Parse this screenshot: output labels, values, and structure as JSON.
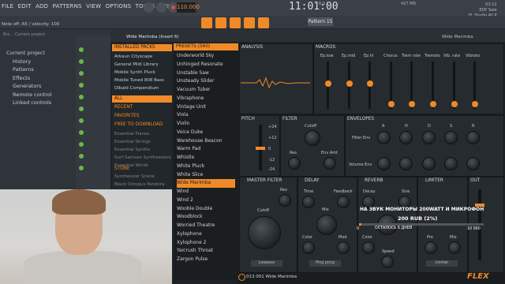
{
  "menu": [
    "FILE",
    "EDIT",
    "ADD",
    "PATTERNS",
    "VIEW",
    "OPTIONS",
    "TOOLS",
    "HELP"
  ],
  "transport": {
    "tempo": "110.000",
    "time": "11:01:00",
    "bst": "B:S:T",
    "pattern": "Pattern 15"
  },
  "hint": "Note off: A5 / velocity: 100",
  "sysinfo": {
    "cpu": "427 MB",
    "line1": "03:12",
    "line2": "EOY Sale",
    "line3": "FL Studio All P"
  },
  "browser": {
    "header": "Bro… Current project",
    "tree": [
      "Current project",
      "History",
      "Patterns",
      "Effects",
      "Generators",
      "Remote control",
      "Linked controls"
    ]
  },
  "plugin": {
    "title": "Wide Marimba (Insert 6)",
    "title_right": "Wide Marimba"
  },
  "library": {
    "installed": "INSTALLED PACKS",
    "items": [
      "Arkaun Cityscape",
      "General Midi Library",
      "Mobile Synth Pluck",
      "Mobile Tuned 808 Bass",
      "Olbald Compendium"
    ],
    "all": "ALL",
    "recent": "RECENT",
    "favorites": "FAVORITES",
    "free": "FREE TO DOWNLOAD",
    "free_items": [
      "Essential Pianos",
      "Essential Strings",
      "Essential Synths",
      "Surf Samsan Synthesizers",
      "Essential Winds"
    ],
    "store": "STORE",
    "store_items": [
      "Synthesizer Scene",
      "Black Octopus Pandora"
    ]
  },
  "presets": {
    "header": "PRESETS (560)",
    "items": [
      "Underworld Sky",
      "Unhinged Resonate",
      "Unstable Saw",
      "Unsteady Slider",
      "Vacuum Tuber",
      "Vibraphone",
      "Vintage Unit",
      "Viola",
      "Violin",
      "Voice Duke",
      "Warehouse Beacon",
      "Warm Pad",
      "Whistle",
      "White Pluck",
      "White Slice",
      "Wide Marimba",
      "Wind",
      "Wind 2",
      "Wooble Double",
      "Woodblock",
      "Worried Theatre",
      "Xylophone",
      "Xylophone 2",
      "Yaicrush Throat",
      "Zargon Pulse"
    ],
    "selected": "Wide Marimba"
  },
  "analysis": {
    "label": "ANALYSIS"
  },
  "macros": {
    "label": "MACROS",
    "knobs": [
      "Ep.low",
      "Ep.mid",
      "Ep.hi",
      "Chorus",
      "Trem rate",
      "Tremolo",
      "Vib. rate",
      "Vibrato"
    ]
  },
  "pitch": {
    "label": "PITCH",
    "ticks": [
      "+24",
      "+12",
      "0",
      "-12",
      "-24"
    ]
  },
  "filter": {
    "label": "FILTER",
    "knobs": [
      "Cutoff",
      "Res",
      "Env Amt"
    ]
  },
  "envelopes": {
    "label": "ENVELOPES",
    "cols": [
      "A",
      "H",
      "D",
      "S",
      "R"
    ],
    "rows": [
      "Filter Env",
      "Volume Env"
    ]
  },
  "master_filter": {
    "label": "MASTER FILTER",
    "knobs": [
      "Res",
      "Cutoff"
    ],
    "mode": "Lowpass"
  },
  "delay": {
    "label": "DELAY",
    "knobs": [
      "Time",
      "Feedback",
      "Mix",
      "Color",
      "Mod"
    ],
    "mode": "Ping pong"
  },
  "reverb": {
    "label": "REVERB",
    "knobs": [
      "Decay",
      "Size",
      "Color",
      "Speed"
    ]
  },
  "limiter": {
    "label": "LIMITER",
    "knobs": [
      "Pre",
      "Mix"
    ],
    "mode": "Limiter"
  },
  "out": {
    "label": "OUT"
  },
  "donation": {
    "line1": "НА ЗВУК МОНИТОРЫ 200WATT И МИКРОФОН",
    "amount": "200 RUB (2%)",
    "remaining": "ОСТАЛОСЬ 6 ДНЕЙ",
    "min": "0",
    "max": "10 000",
    "progress": 0.02
  },
  "footer": {
    "text": "013 001 Wide Marimba",
    "logo": "FLEX"
  }
}
